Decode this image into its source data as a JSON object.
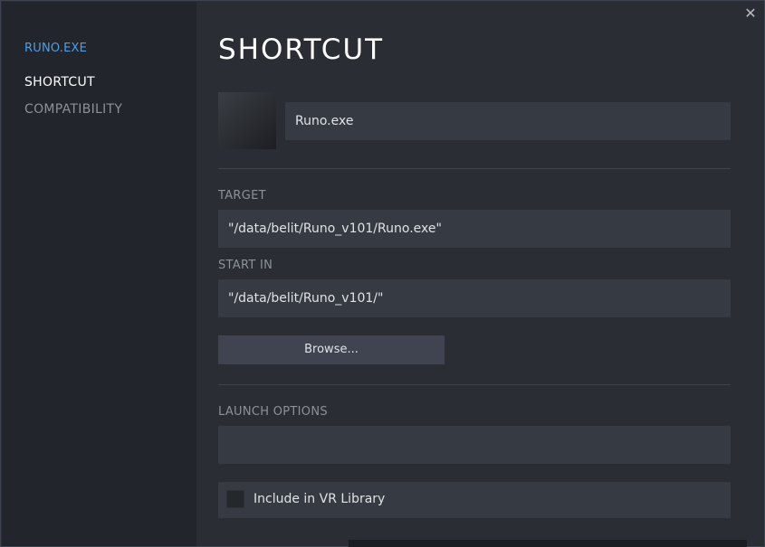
{
  "sidebar": {
    "app_name": "RUNO.EXE",
    "items": [
      {
        "label": "SHORTCUT",
        "active": true
      },
      {
        "label": "COMPATIBILITY",
        "active": false
      }
    ]
  },
  "header": {
    "title": "SHORTCUT",
    "close_icon": "close-icon"
  },
  "shortcut": {
    "name_value": "Runo.exe",
    "target_label": "TARGET",
    "target_value": "\"/data/belit/Runo_v101/Runo.exe\"",
    "startin_label": "START IN",
    "startin_value": "\"/data/belit/Runo_v101/\"",
    "browse_label": "Browse...",
    "launch_label": "LAUNCH OPTIONS",
    "launch_value": "",
    "vr_label": "Include in VR Library",
    "vr_checked": false
  },
  "colors": {
    "accent": "#4d9fe8",
    "panel": "#2a2d34",
    "sidebar": "#22252b",
    "field": "#363a42"
  }
}
